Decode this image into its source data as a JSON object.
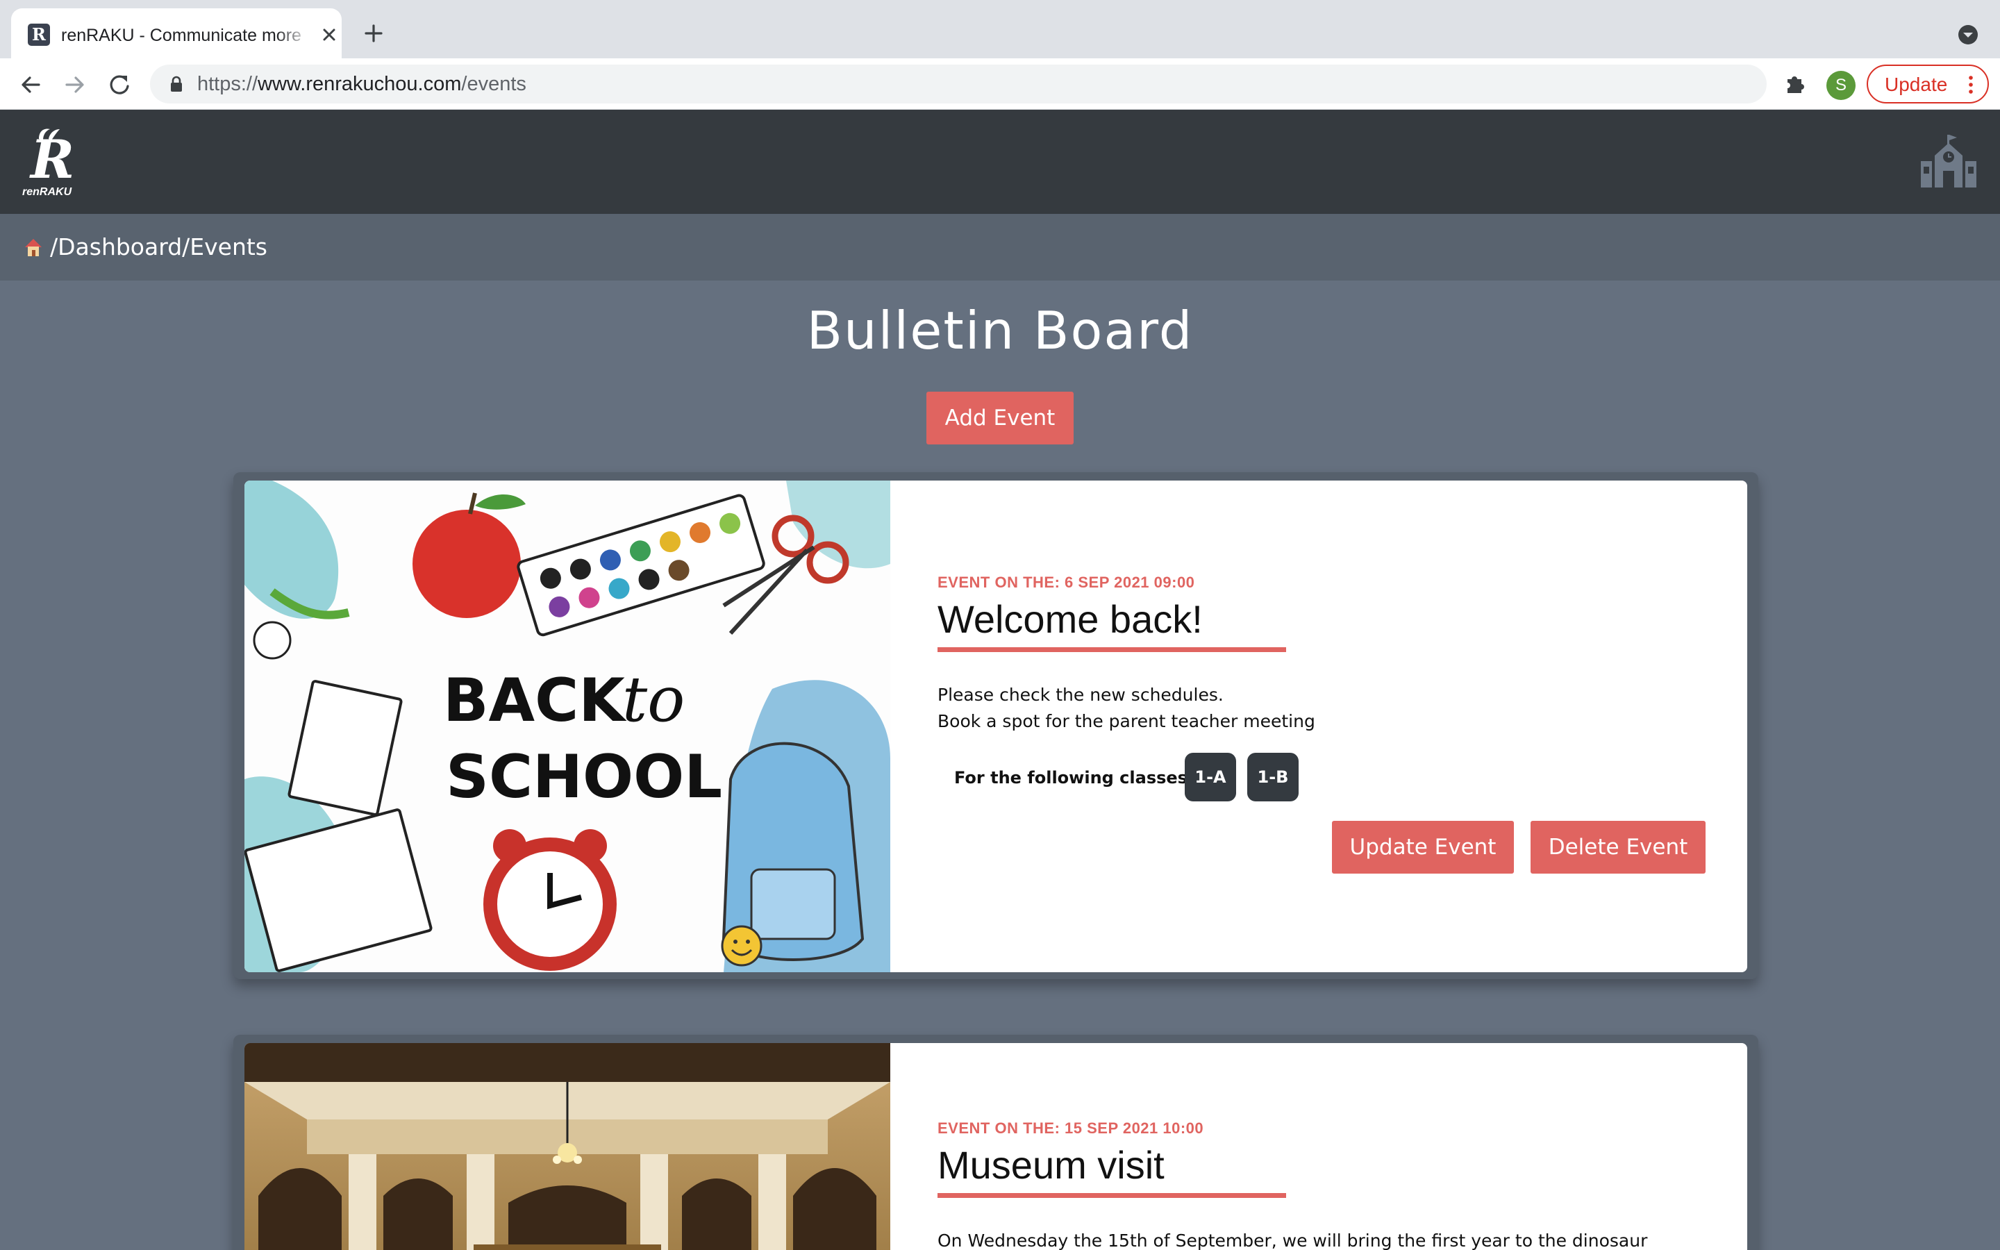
{
  "browser": {
    "tab_title": "renRAKU - Communicate more",
    "favicon_letter": "R",
    "url_scheme": "https://",
    "url_host": "www.renrakuchou.com",
    "url_path": "/events",
    "profile_initial": "S",
    "update_label": "Update"
  },
  "app": {
    "logo_letter": "R",
    "logo_text": "renRAKU",
    "breadcrumb": "/Dashboard/Events"
  },
  "main": {
    "title": "Bulletin Board",
    "add_label": "Add Event"
  },
  "events": [
    {
      "date": "EVENT ON THE: 6 SEP 2021 09:00",
      "title": "Welcome back!",
      "lines": [
        "Please check the new schedules.",
        "Book a spot for the parent teacher meeting"
      ],
      "classes_label": "For the following classes:",
      "classes": [
        "1-A",
        "1-B"
      ],
      "update_label": "Update Event",
      "delete_label": "Delete Event",
      "image_text_1": "BACK",
      "image_text_2": "to",
      "image_text_3": "SCHOOL"
    },
    {
      "date": "EVENT ON THE: 15 SEP 2021 10:00",
      "title": "Museum visit",
      "lines": [
        "On Wednesday the 15th of September, we will bring the first year to the dinosaur"
      ]
    }
  ],
  "colors": {
    "accent": "#e06460",
    "header_bg": "#353a3f",
    "page_bg": "#65707f",
    "badge_bg": "#343a40"
  },
  "icons": [
    "back-arrow-icon",
    "forward-arrow-icon",
    "reload-icon",
    "lock-icon",
    "star-icon",
    "puzzle-icon",
    "home-icon",
    "school-icon",
    "close-icon",
    "plus-icon"
  ]
}
